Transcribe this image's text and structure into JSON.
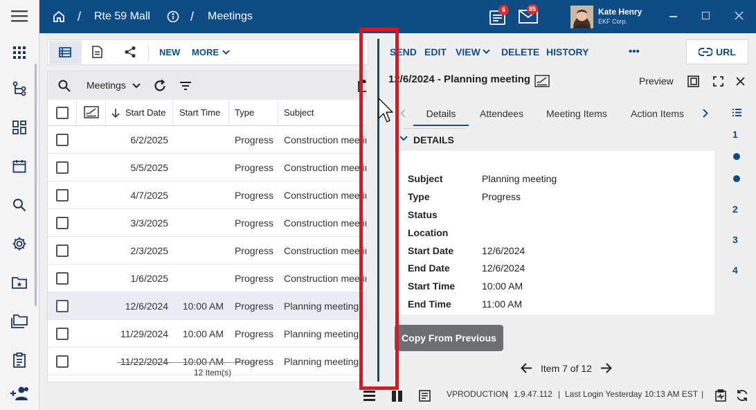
{
  "breadcrumb": {
    "project": "Rte 59 Mall",
    "module": "Meetings",
    "separator": "/"
  },
  "notifications": {
    "tasks_count": "6",
    "mail_count": "85"
  },
  "user": {
    "name": "Kate Henry",
    "org": "EKF Corp."
  },
  "left_toolbar": {
    "new_label": "NEW",
    "more_label": "MORE"
  },
  "list": {
    "view_name": "Meetings",
    "columns": {
      "start_date": "Start Date",
      "start_time": "Start Time",
      "type": "Type",
      "subject": "Subject"
    },
    "rows": [
      {
        "start_date": "6/2/2025",
        "start_time": "",
        "type": "Progress",
        "subject": "Construction meeting"
      },
      {
        "start_date": "5/5/2025",
        "start_time": "",
        "type": "Progress",
        "subject": "Construction meeting"
      },
      {
        "start_date": "4/7/2025",
        "start_time": "",
        "type": "Progress",
        "subject": "Construction meeting"
      },
      {
        "start_date": "3/3/2025",
        "start_time": "",
        "type": "Progress",
        "subject": "Construction meeting"
      },
      {
        "start_date": "2/3/2025",
        "start_time": "",
        "type": "Progress",
        "subject": "Construction meeting"
      },
      {
        "start_date": "1/6/2025",
        "start_time": "",
        "type": "Progress",
        "subject": "Construction meeting"
      },
      {
        "start_date": "12/6/2024",
        "start_time": "10:00 AM",
        "type": "Progress",
        "subject": "Planning meeting"
      },
      {
        "start_date": "11/29/2024",
        "start_time": "10:00 AM",
        "type": "Progress",
        "subject": "Planning meeting"
      },
      {
        "start_date": "11/22/2024",
        "start_time": "10:00 AM",
        "type": "Progress",
        "subject": "Planning meeting"
      }
    ],
    "item_count": "12 Item(s)"
  },
  "actions": {
    "send": "SEND",
    "edit": "EDIT",
    "view": "VIEW",
    "delete": "DELETE",
    "history": "HISTORY",
    "more": "•••",
    "url": "URL"
  },
  "detail": {
    "title": "12/6/2024 - Planning meeting",
    "preview_label": "Preview",
    "tabs": [
      "Details",
      "Attendees",
      "Meeting Items",
      "Action Items"
    ],
    "section_title": "DETAILS",
    "fields": [
      {
        "label": "Subject",
        "value": "Planning meeting"
      },
      {
        "label": "Type",
        "value": "Progress"
      },
      {
        "label": "Status",
        "value": ""
      },
      {
        "label": "Location",
        "value": ""
      },
      {
        "label": "Start Date",
        "value": "12/6/2024"
      },
      {
        "label": "End Date",
        "value": "12/6/2024"
      },
      {
        "label": "Start Time",
        "value": "10:00 AM"
      },
      {
        "label": "End Time",
        "value": "11:00 AM"
      }
    ],
    "section_nav": [
      "1",
      "2",
      "3",
      "4"
    ],
    "copy_button": "Copy From Previous",
    "pager": "Item 7 of 12"
  },
  "status_bar": {
    "environment": "VPRODUCTION",
    "version": "1.9.47.112",
    "last_login": "Last Login Yesterday 10:13 AM EST",
    "separator": "|"
  },
  "colors": {
    "primary": "#0f4c85",
    "highlight": "#e0141e",
    "badge": "#d32f2f"
  }
}
